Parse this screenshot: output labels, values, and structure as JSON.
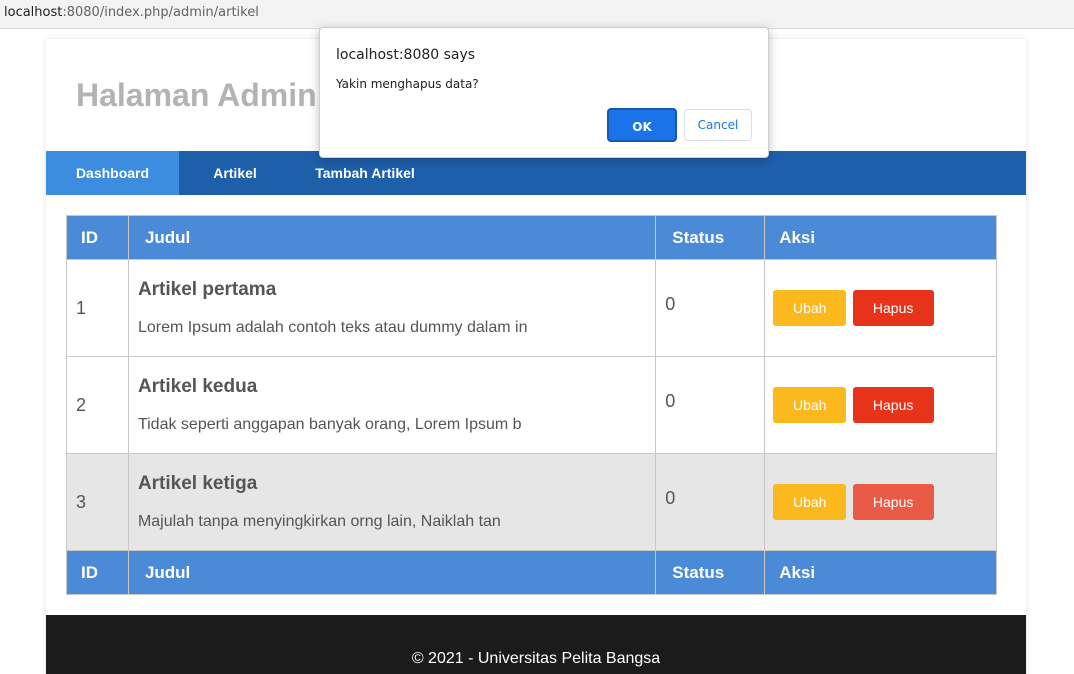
{
  "browser": {
    "url_host": "localhost",
    "url_rest": ":8080/index.php/admin/artikel"
  },
  "header": {
    "title": "Halaman Admin"
  },
  "nav": {
    "items": [
      {
        "label": "Dashboard"
      },
      {
        "label": "Artikel"
      },
      {
        "label": "Tambah Artikel"
      }
    ]
  },
  "table": {
    "headers": {
      "id": "ID",
      "judul": "Judul",
      "status": "Status",
      "aksi": "Aksi"
    },
    "rows": [
      {
        "id": "1",
        "title": "Artikel pertama",
        "excerpt": "Lorem Ipsum adalah contoh teks atau dummy dalam in",
        "status": "0",
        "edit": "Ubah",
        "delete": "Hapus"
      },
      {
        "id": "2",
        "title": "Artikel kedua",
        "excerpt": "Tidak seperti anggapan banyak orang, Lorem Ipsum b",
        "status": "0",
        "edit": "Ubah",
        "delete": "Hapus"
      },
      {
        "id": "3",
        "title": "Artikel ketiga",
        "excerpt": "Majulah tanpa menyingkirkan orng lain, Naiklah tan",
        "status": "0",
        "edit": "Ubah",
        "delete": "Hapus"
      }
    ]
  },
  "footer": {
    "text": "© 2021 - Universitas Pelita Bangsa"
  },
  "dialog": {
    "title": "localhost:8080 says",
    "message": "Yakin menghapus data?",
    "ok": "OK",
    "cancel": "Cancel"
  },
  "colors": {
    "nav": "#1e5faa",
    "nav_active": "#3c8de0",
    "table_header": "#4b8ad6",
    "btn_ubah": "#fbb91e",
    "btn_hapus": "#e8331b",
    "dialog_ok": "#1a73e8"
  }
}
